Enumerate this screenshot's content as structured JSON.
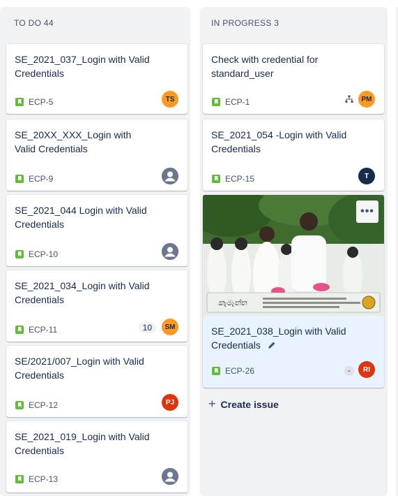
{
  "columns": [
    {
      "header": "TO DO 44",
      "cards": [
        {
          "title": "SE_2021_037_Login with Valid Credentials",
          "key": "ECP-5",
          "avatar": "TS"
        },
        {
          "title": "SE_20XX_XXX_Login with Valid Credentials",
          "key": "ECP-9",
          "avatar": ""
        },
        {
          "title": "SE_2021_044 Login with Valid Credentials",
          "key": "ECP-10",
          "avatar": ""
        },
        {
          "title": "SE_2021_034_Login with Valid Credentials",
          "key": "ECP-11",
          "avatar": "SM",
          "badge": "10"
        },
        {
          "title": "SE/2021/007_Login with Valid Credentials",
          "key": "ECP-12",
          "avatar": "PJ"
        },
        {
          "title": "SE_2021_019_Login with Valid Credentials",
          "key": "ECP-13",
          "avatar": ""
        }
      ]
    },
    {
      "header": "IN PROGRESS 3",
      "cards": [
        {
          "title": "Check with credential for standard_user",
          "key": "ECP-1",
          "avatar": "PM",
          "icon": "hierarchy-icon"
        },
        {
          "title": "SE_2021_054 -Login with Valid Credentials",
          "key": "ECP-15",
          "avatar": "T"
        },
        {
          "title": "SE_2021_038_Login with Valid Credentials",
          "key": "ECP-26",
          "avatar": "RI",
          "badge": "-",
          "more": "•••",
          "cover_caption": "කැමැත්ත"
        }
      ],
      "create_label": "Create issue"
    }
  ],
  "colors": {
    "story": "#63ba3c",
    "column_bg": "#f1f2f4",
    "selected_card": "#e9f2ff"
  }
}
